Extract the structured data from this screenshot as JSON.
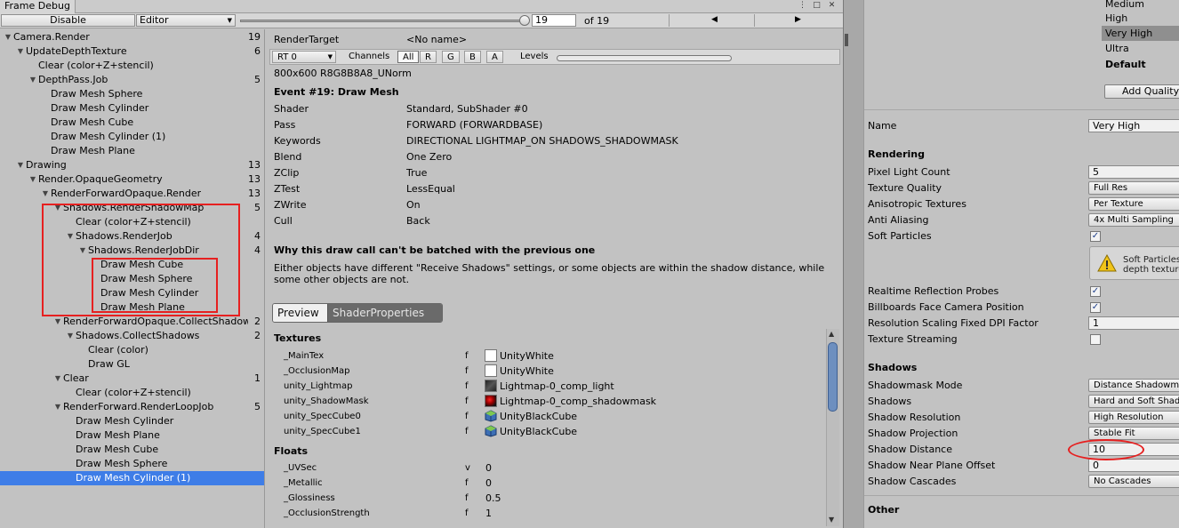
{
  "window": {
    "title": "Frame Debug"
  },
  "toolbar": {
    "disable_label": "Disable",
    "mode_value": "Editor",
    "frame_value": "19",
    "frame_total": "of 19",
    "frame_fraction": 1.0
  },
  "tree": [
    {
      "label": "Camera.Render",
      "count": "19",
      "depth": 0,
      "arrow": true
    },
    {
      "label": "UpdateDepthTexture",
      "count": "6",
      "depth": 1,
      "arrow": true
    },
    {
      "label": "Clear (color+Z+stencil)",
      "count": "",
      "depth": 2,
      "arrow": false
    },
    {
      "label": "DepthPass.Job",
      "count": "5",
      "depth": 2,
      "arrow": true
    },
    {
      "label": "Draw Mesh Sphere",
      "count": "",
      "depth": 3,
      "arrow": false
    },
    {
      "label": "Draw Mesh Cylinder",
      "count": "",
      "depth": 3,
      "arrow": false
    },
    {
      "label": "Draw Mesh Cube",
      "count": "",
      "depth": 3,
      "arrow": false
    },
    {
      "label": "Draw Mesh Cylinder (1)",
      "count": "",
      "depth": 3,
      "arrow": false
    },
    {
      "label": "Draw Mesh Plane",
      "count": "",
      "depth": 3,
      "arrow": false
    },
    {
      "label": "Drawing",
      "count": "13",
      "depth": 1,
      "arrow": true
    },
    {
      "label": "Render.OpaqueGeometry",
      "count": "13",
      "depth": 2,
      "arrow": true
    },
    {
      "label": "RenderForwardOpaque.Render",
      "count": "13",
      "depth": 3,
      "arrow": true
    },
    {
      "label": "Shadows.RenderShadowMap",
      "count": "5",
      "depth": 4,
      "arrow": true
    },
    {
      "label": "Clear (color+Z+stencil)",
      "count": "",
      "depth": 5,
      "arrow": false
    },
    {
      "label": "Shadows.RenderJob",
      "count": "4",
      "depth": 5,
      "arrow": true
    },
    {
      "label": "Shadows.RenderJobDir",
      "count": "4",
      "depth": 6,
      "arrow": true
    },
    {
      "label": "Draw Mesh Cube",
      "count": "",
      "depth": 7,
      "arrow": false
    },
    {
      "label": "Draw Mesh Sphere",
      "count": "",
      "depth": 7,
      "arrow": false
    },
    {
      "label": "Draw Mesh Cylinder",
      "count": "",
      "depth": 7,
      "arrow": false
    },
    {
      "label": "Draw Mesh Plane",
      "count": "",
      "depth": 7,
      "arrow": false
    },
    {
      "label": "RenderForwardOpaque.CollectShadows",
      "count": "2",
      "depth": 4,
      "arrow": true
    },
    {
      "label": "Shadows.CollectShadows",
      "count": "2",
      "depth": 5,
      "arrow": true
    },
    {
      "label": "Clear (color)",
      "count": "",
      "depth": 6,
      "arrow": false
    },
    {
      "label": "Draw GL",
      "count": "",
      "depth": 6,
      "arrow": false
    },
    {
      "label": "Clear",
      "count": "1",
      "depth": 4,
      "arrow": true
    },
    {
      "label": "Clear (color+Z+stencil)",
      "count": "",
      "depth": 5,
      "arrow": false
    },
    {
      "label": "RenderForward.RenderLoopJob",
      "count": "5",
      "depth": 4,
      "arrow": true
    },
    {
      "label": "Draw Mesh Cylinder",
      "count": "",
      "depth": 5,
      "arrow": false
    },
    {
      "label": "Draw Mesh Plane",
      "count": "",
      "depth": 5,
      "arrow": false
    },
    {
      "label": "Draw Mesh Cube",
      "count": "",
      "depth": 5,
      "arrow": false
    },
    {
      "label": "Draw Mesh Sphere",
      "count": "",
      "depth": 5,
      "arrow": false
    },
    {
      "label": "Draw Mesh Cylinder (1)",
      "count": "",
      "depth": 5,
      "arrow": false,
      "selected": true
    }
  ],
  "details": {
    "render_target_label": "RenderTarget",
    "render_target_value": "<No name>",
    "rt_dropdown": "RT 0",
    "channels_label": "Channels",
    "channels": [
      "All",
      "R",
      "G",
      "B",
      "A"
    ],
    "levels_label": "Levels",
    "format": "800x600 R8G8B8A8_UNorm",
    "event_title": "Event #19: Draw Mesh",
    "rows": [
      {
        "label": "Shader",
        "value": "Standard, SubShader #0"
      },
      {
        "label": "Pass",
        "value": "FORWARD (FORWARDBASE)"
      },
      {
        "label": "Keywords",
        "value": "DIRECTIONAL LIGHTMAP_ON SHADOWS_SHADOWMASK"
      },
      {
        "label": "Blend",
        "value": "One Zero"
      },
      {
        "label": "ZClip",
        "value": "True"
      },
      {
        "label": "ZTest",
        "value": "LessEqual"
      },
      {
        "label": "ZWrite",
        "value": "On"
      },
      {
        "label": "Cull",
        "value": "Back"
      }
    ],
    "batch_title": "Why this draw call can't be batched with the previous one",
    "batch_text": "Either objects have different \"Receive Shadows\" settings, or some objects are within the shadow distance, while some other objects are not.",
    "tab_preview": "Preview",
    "tab_shader": "ShaderProperties",
    "textures_title": "Textures",
    "textures": [
      {
        "name": "_MainTex",
        "type": "f",
        "value": "UnityWhite",
        "thumb": "white"
      },
      {
        "name": "_OcclusionMap",
        "type": "f",
        "value": "UnityWhite",
        "thumb": "white"
      },
      {
        "name": "unity_Lightmap",
        "type": "f",
        "value": "Lightmap-0_comp_light",
        "thumb": "dark"
      },
      {
        "name": "unity_ShadowMask",
        "type": "f",
        "value": "Lightmap-0_comp_shadowmask",
        "thumb": "red"
      },
      {
        "name": "unity_SpecCube0",
        "type": "f",
        "value": "UnityBlackCube",
        "thumb": "cube"
      },
      {
        "name": "unity_SpecCube1",
        "type": "f",
        "value": "UnityBlackCube",
        "thumb": "cube"
      }
    ],
    "floats_title": "Floats",
    "floats": [
      {
        "name": "_UVSec",
        "type": "v",
        "value": "0"
      },
      {
        "name": "_Metallic",
        "type": "f",
        "value": "0"
      },
      {
        "name": "_Glossiness",
        "type": "f",
        "value": "0.5"
      },
      {
        "name": "_OcclusionStrength",
        "type": "f",
        "value": "1"
      }
    ]
  },
  "quality": {
    "levels": [
      {
        "label": "Medium",
        "selected": false,
        "bold": false
      },
      {
        "label": "High",
        "selected": false,
        "bold": false
      },
      {
        "label": "Very High",
        "selected": true,
        "bold": false
      },
      {
        "label": "Ultra",
        "selected": false,
        "bold": false
      },
      {
        "label": "Default",
        "selected": false,
        "bold": true
      }
    ],
    "add_button": "Add Quality",
    "name_label": "Name",
    "name_value": "Very High",
    "rendering_title": "Rendering",
    "pixel_light_count_label": "Pixel Light Count",
    "pixel_light_count_value": "5",
    "texture_quality_label": "Texture Quality",
    "texture_quality_value": "Full Res",
    "aniso_label": "Anisotropic Textures",
    "aniso_value": "Per Texture",
    "aa_label": "Anti Aliasing",
    "aa_value": "4x Multi Sampling",
    "soft_particles_label": "Soft Particles",
    "soft_particles_help_1": "Soft Particles",
    "soft_particles_help_2": "depth texture",
    "realtime_reflection_label": "Realtime Reflection Probes",
    "billboards_label": "Billboards Face Camera Position",
    "dpi_label": "Resolution Scaling Fixed DPI Factor",
    "dpi_value": "1",
    "streaming_label": "Texture Streaming",
    "shadows_title": "Shadows",
    "shadowmask_label": "Shadowmask Mode",
    "shadowmask_value": "Distance Shadowmask",
    "shadows_label": "Shadows",
    "shadows_value": "Hard and Soft Shadows",
    "shadow_res_label": "Shadow Resolution",
    "shadow_res_value": "High Resolution",
    "shadow_proj_label": "Shadow Projection",
    "shadow_proj_value": "Stable Fit",
    "shadow_dist_label": "Shadow Distance",
    "shadow_dist_value": "10",
    "shadow_near_label": "Shadow Near Plane Offset",
    "shadow_near_value": "0",
    "cascades_label": "Shadow Cascades",
    "cascades_value": "No Cascades",
    "other_title": "Other"
  }
}
